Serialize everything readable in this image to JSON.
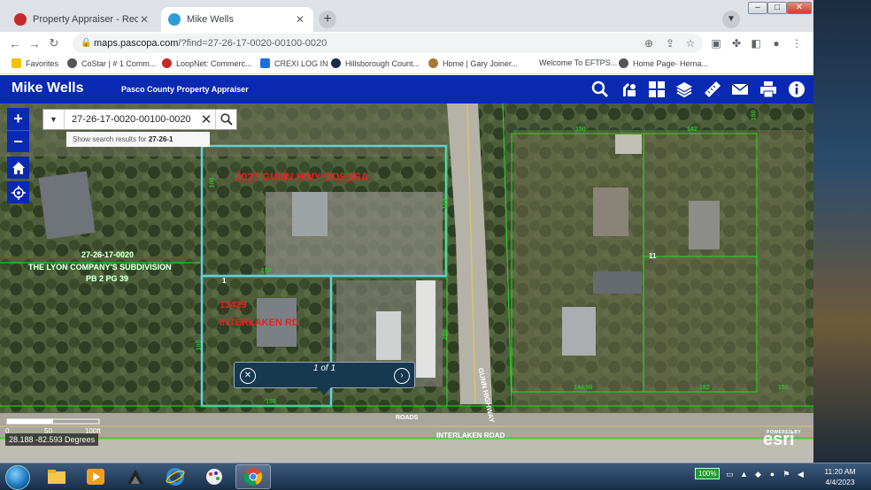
{
  "tabs": [
    {
      "title": "Property Appraiser - Record Sear",
      "active": false,
      "favicon": "pasco-favicon"
    },
    {
      "title": "Mike Wells",
      "active": true,
      "favicon": "arcgis-favicon"
    }
  ],
  "url": {
    "host": "maps.pascopa.com",
    "path": "/?find=27-26-17-0020-00100-0020"
  },
  "bookmarks": [
    "Favorites",
    "CoStar | # 1 Comm...",
    "LoopNet: Commerc...",
    "CREXI LOG IN",
    "Hillsborough Count...",
    "Home | Gary Joiner...",
    "Welcome To EFTPS...",
    "Home Page- Herna..."
  ],
  "app": {
    "title": "Mike Wells",
    "subtitle": "Pasco County Property Appraiser"
  },
  "header_icons": [
    "search-icon",
    "identify-icon",
    "basemap-gallery-icon",
    "layers-icon",
    "measure-icon",
    "email-icon",
    "print-icon",
    "info-icon"
  ],
  "search": {
    "value": "27-26-17-0020-00100-0020",
    "suggestion_prefix": "Show search results for ",
    "suggestion_term": "27-26-1"
  },
  "labels": {
    "parcel_address_1": "2027 GUNN HWY ODESSA",
    "parcel_address_2_line1": "13429",
    "parcel_address_2_line2": "INTERLAKEN RD",
    "subdivision_id": "27-26-17-0020",
    "subdivision_name": "THE LYON COMPANY'S SUBDIVISION",
    "subdivision_plat": "PB 2 PG 39",
    "road_gunn": "GUNN HIGHWAY",
    "road_interlaken": "INTERLAKEN ROAD",
    "roads_label": "ROADS",
    "lot_1": "1",
    "lot_11": "11"
  },
  "dimensions": [
    "100",
    "150",
    "100",
    "150",
    "200",
    "150",
    "150",
    "142",
    "150",
    "144.50",
    "182",
    "150"
  ],
  "popup": {
    "page": "1 of 1"
  },
  "scale": {
    "ticks": [
      "0",
      "50",
      "100ft"
    ]
  },
  "coordinates": "28.188 -82.593 Degrees",
  "esri": {
    "powered_by": "POWERED BY",
    "name": "esri"
  },
  "taskbar": {
    "battery": "100%",
    "time": "11:20 AM",
    "date": "4/4/2023",
    "apps": [
      "file-explorer-icon",
      "media-player-icon",
      "app-icon",
      "internet-explorer-icon",
      "paint-icon",
      "chrome-icon"
    ]
  },
  "colors": {
    "brand": "#0a29b3",
    "parcel_outline": "#5fd0e0",
    "parcel_line": "#22dd22",
    "label_red": "#e62020",
    "popup_bg": "#16394f"
  }
}
